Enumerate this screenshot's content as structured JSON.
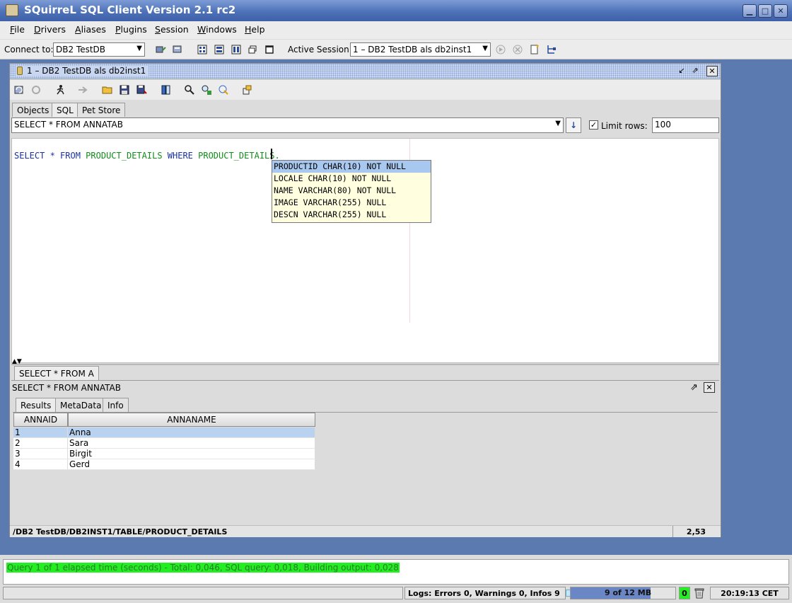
{
  "window": {
    "title": "SQuirreL SQL Client Version 2.1 rc2"
  },
  "menu": [
    {
      "label": "File"
    },
    {
      "label": "Drivers"
    },
    {
      "label": "Aliases"
    },
    {
      "label": "Plugins"
    },
    {
      "label": "Session"
    },
    {
      "label": "Windows"
    },
    {
      "label": "Help"
    }
  ],
  "toolbar": {
    "connect_label": "Connect to:",
    "connect_value": "DB2 TestDB",
    "active_session_label": "Active Session:",
    "active_session_value": "1 – DB2 TestDB  als db2inst1"
  },
  "session": {
    "title": "1 – DB2 TestDB  als db2inst1",
    "tabs": [
      {
        "label": "Objects"
      },
      {
        "label": "SQL"
      },
      {
        "label": "Pet Store"
      }
    ],
    "history_value": "SELECT * FROM ANNATAB",
    "limit_rows_label": "Limit rows:",
    "limit_rows_value": "100",
    "limit_rows_checked": true
  },
  "editor": {
    "kw_select": "SELECT",
    "star": " * ",
    "kw_from": "FROM",
    "table": " PRODUCT_DETAILS ",
    "kw_where": "WHERE",
    "column_prefix": " PRODUCT_DETAILS."
  },
  "autocomplete": [
    {
      "text": "PRODUCTID  CHAR(10) NOT NULL",
      "selected": true
    },
    {
      "text": "LOCALE  CHAR(10) NOT NULL",
      "selected": false
    },
    {
      "text": "NAME  VARCHAR(80) NOT NULL",
      "selected": false
    },
    {
      "text": "IMAGE  VARCHAR(255) NULL",
      "selected": false
    },
    {
      "text": "DESCN  VARCHAR(255) NULL",
      "selected": false
    }
  ],
  "results": {
    "query_tab": "SELECT * FROM A",
    "query_text": "SELECT * FROM ANNATAB",
    "tabs": [
      {
        "label": "Results"
      },
      {
        "label": "MetaData"
      },
      {
        "label": "Info"
      }
    ],
    "columns": [
      "ANNAID",
      "ANNANAME"
    ],
    "rows": [
      {
        "id": "1",
        "name": "Anna"
      },
      {
        "id": "2",
        "name": "Sara"
      },
      {
        "id": "3",
        "name": "Birgit"
      },
      {
        "id": "4",
        "name": "Gerd"
      }
    ]
  },
  "pathbar": {
    "path": "/DB2 TestDB/DB2INST1/TABLE/PRODUCT_DETAILS",
    "position": "2,53"
  },
  "message": "Query 1 of 1 elapsed time (seconds) - Total: 0,046, SQL query: 0,018, Building output: 0,028",
  "status": {
    "logs": "Logs: Errors 0, Warnings 0, Infos 9",
    "memory": "9 of 12 MB",
    "memory_used_fraction": 0.75,
    "zero": "0",
    "time": "20:19:13 CET"
  }
}
